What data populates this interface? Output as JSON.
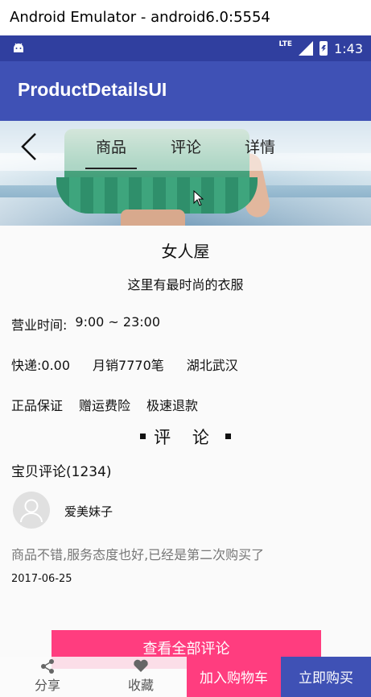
{
  "window": {
    "title": "Android Emulator - android6.0:5554"
  },
  "statusbar": {
    "network": "LTE",
    "time": "1:43",
    "icons": [
      "android-icon",
      "signal-icon",
      "battery-icon"
    ]
  },
  "appbar": {
    "title": "ProductDetailsUI"
  },
  "nav": {
    "back_icon": "chevron-left-icon",
    "tabs": [
      {
        "label": "商品",
        "active": true
      },
      {
        "label": "评论",
        "active": false
      },
      {
        "label": "详情",
        "active": false
      }
    ]
  },
  "shop": {
    "name": "女人屋",
    "slogan": "这里有最时尚的衣服",
    "hours_label": "营业时间:",
    "hours_value": "9:00 ~ 23:00",
    "shipping": "快递:0.00",
    "monthly_sales": "月销7770笔",
    "location": "湖北武汉",
    "promises": [
      "正品保证",
      "赠运费险",
      "极速退款"
    ]
  },
  "reviews": {
    "section_title": "评 论",
    "count_label": "宝贝评论(1234)",
    "items": [
      {
        "user": "爱美妹子",
        "text": "商品不错,服务态度也好,已经是第二次购买了",
        "date": "2017-06-25"
      }
    ],
    "view_all_label": "查看全部评论"
  },
  "bottom_bar": {
    "share_label": "分享",
    "favorite_label": "收藏",
    "add_to_cart_label": "加入购物车",
    "buy_now_label": "立即购买"
  },
  "colors": {
    "primary": "#3f51b5",
    "primary_dark": "#303f9f",
    "accent": "#ff3d7f"
  }
}
